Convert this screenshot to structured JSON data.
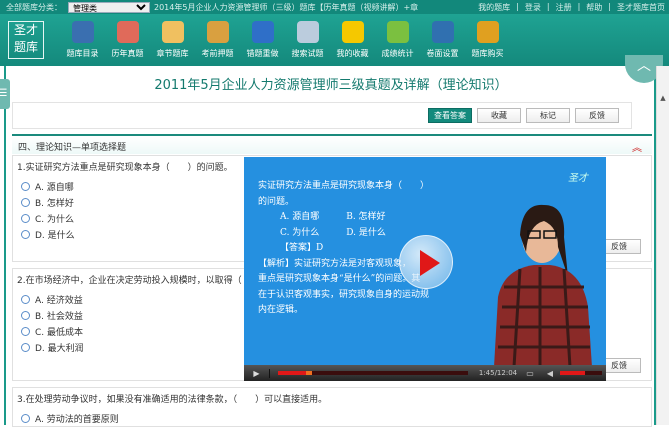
{
  "topbar": {
    "category_label": "全部题库分类：",
    "category_value": "管理类",
    "course_title": "2014年5月企业人力资源管理师（三级）题库【历年真题（视频讲解）+章",
    "links": [
      "我的题库",
      "登录",
      "注册",
      "帮助",
      "圣才题库首页"
    ]
  },
  "logo": "圣才题库",
  "toolbar": [
    {
      "label": "题库目录",
      "icon": "catalog-icon",
      "color": "#3a6fb0"
    },
    {
      "label": "历年真题",
      "icon": "past-exams-icon",
      "color": "#e06a5a"
    },
    {
      "label": "章节题库",
      "icon": "chapter-icon",
      "color": "#f0c060"
    },
    {
      "label": "考前押题",
      "icon": "predict-icon",
      "color": "#d9a040"
    },
    {
      "label": "错题重做",
      "icon": "redo-icon",
      "color": "#2f6fc8"
    },
    {
      "label": "搜索试题",
      "icon": "search-icon",
      "color": "#bcd"
    },
    {
      "label": "我的收藏",
      "icon": "favorites-icon",
      "color": "#f5c800"
    },
    {
      "label": "成绩统计",
      "icon": "stats-icon",
      "color": "#7bc040"
    },
    {
      "label": "卷面设置",
      "icon": "settings-icon",
      "color": "#3070b0"
    },
    {
      "label": "题库购买",
      "icon": "cart-icon",
      "color": "#e0a020"
    }
  ],
  "page_title": "2011年5月企业人力资源管理师三级真题及详解（理论知识）",
  "actions": {
    "answer": "查看答案",
    "collect": "收藏",
    "mark": "标记",
    "feedback": "反馈"
  },
  "section_title": "四、理论知识—单项选择题",
  "questions": [
    {
      "stem": "1.实证研究方法重点是研究现象本身（　　）的问题。",
      "options": [
        "A. 源自哪",
        "B. 怎样好",
        "C. 为什么",
        "D. 是什么"
      ],
      "feedback": "反馈"
    },
    {
      "stem": "2.在市场经济中，企业在决定劳动投入规模时，以取得（",
      "options": [
        "A. 经济效益",
        "B. 社会效益",
        "C. 最低成本",
        "D. 最大利润"
      ],
      "feedback": "反馈"
    },
    {
      "stem": "3.在处理劳动争议时，如果没有准确适用的法律条款，（　　）可以直接适用。",
      "options": [
        "A. 劳动法的首要原则"
      ]
    }
  ],
  "video": {
    "watermark": "圣才",
    "lines": [
      "实证研究方法重点是研究现象本身（　　）",
      "的问题。",
      "A. 源自哪　　　B. 怎样好",
      "C. 为什么　　　D. 是什么",
      "【答案】D",
      "【解析】实证研究方法是对客观现象，",
      "重点是研究现象本身“是什么”的问题。其",
      "在于认识客观事实，研究现象自身的运动规",
      "内在逻辑。"
    ],
    "time": "1:45/12:04",
    "progress": 0.145,
    "volume": 0.6
  }
}
